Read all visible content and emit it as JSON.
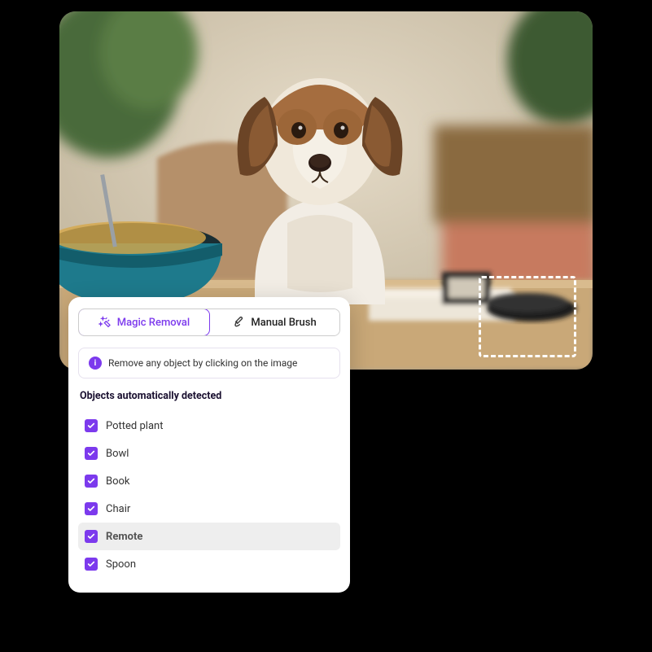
{
  "tabs": {
    "magic": "Magic Removal",
    "brush": "Manual Brush"
  },
  "info": {
    "text": "Remove any object by clicking on the image"
  },
  "section": {
    "title": "Objects automatically detected"
  },
  "objects": [
    {
      "label": "Potted plant",
      "highlight": false
    },
    {
      "label": "Bowl",
      "highlight": false
    },
    {
      "label": "Book",
      "highlight": false
    },
    {
      "label": "Chair",
      "highlight": false
    },
    {
      "label": "Remote",
      "highlight": true
    },
    {
      "label": "Spoon",
      "highlight": false
    }
  ]
}
